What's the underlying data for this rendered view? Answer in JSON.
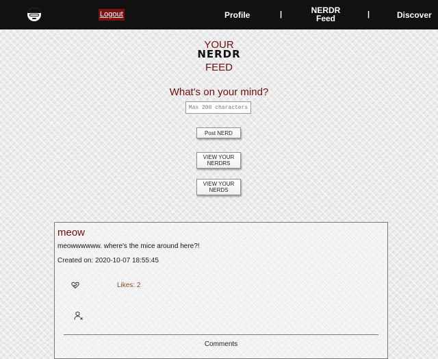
{
  "nav": {
    "logo_icon": "nerd-face-icon",
    "logout_label": "Logout",
    "profile_label": "Profile",
    "separator": "|",
    "feed_line1": "NERDR",
    "feed_line2": "Feed",
    "discover_label": "Discover"
  },
  "header": {
    "line1": "YOUR",
    "line2": "NERDR",
    "line3": "FEED"
  },
  "compose": {
    "prompt": "What's on your mind?",
    "placeholder": "Max 200 characters",
    "post_button": "Post NERD",
    "view_nerdrs_line1": "VIEW YOUR",
    "view_nerdrs_line2": "NERDRS",
    "view_nerds_line1": "VIEW YOUR",
    "view_nerds_line2": "NERDS"
  },
  "posts": [
    {
      "title": "meow",
      "body": "meowwwwww. where's the mice around here?!",
      "created": "Created on: 2020-10-07 18:55:45",
      "likes": "Likes: 2",
      "comments_label": "Comments"
    }
  ],
  "colors": {
    "accent": "#6e0e0e",
    "navbar": "#111111",
    "logout_bg": "#7a1212"
  }
}
